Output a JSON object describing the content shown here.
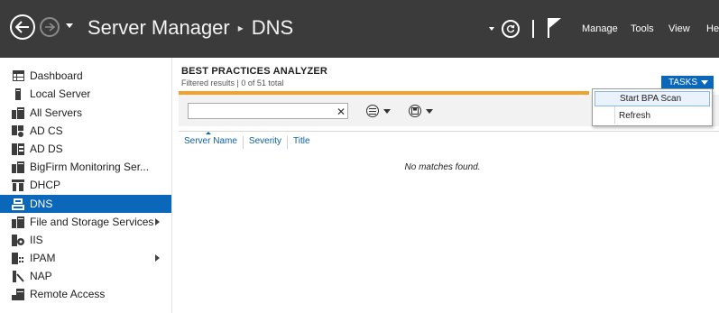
{
  "titlebar": {
    "crumbs": [
      "Server Manager",
      "DNS"
    ],
    "menus": [
      "Manage",
      "Tools",
      "View",
      "He"
    ]
  },
  "icons": {
    "back": "back-arrow-icon",
    "forward": "forward-arrow-icon",
    "refresh": "refresh-icon",
    "notifications": "flag-icon"
  },
  "sidebar": {
    "items": [
      {
        "label": "Dashboard",
        "icon": "dashboard-icon"
      },
      {
        "label": "Local Server",
        "icon": "local-server-icon"
      },
      {
        "label": "All Servers",
        "icon": "all-servers-icon"
      },
      {
        "label": "AD CS",
        "icon": "ad-cs-icon"
      },
      {
        "label": "AD DS",
        "icon": "ad-ds-icon"
      },
      {
        "label": "BigFirm Monitoring Ser...",
        "icon": "server-group-icon"
      },
      {
        "label": "DHCP",
        "icon": "dhcp-icon"
      },
      {
        "label": "DNS",
        "icon": "dns-icon",
        "selected": true
      },
      {
        "label": "File and Storage Services",
        "icon": "file-storage-icon",
        "expandable": true
      },
      {
        "label": "IIS",
        "icon": "iis-icon"
      },
      {
        "label": "IPAM",
        "icon": "ipam-icon",
        "expandable": true
      },
      {
        "label": "NAP",
        "icon": "nap-icon"
      },
      {
        "label": "Remote Access",
        "icon": "remote-access-icon"
      }
    ]
  },
  "main": {
    "title": "BEST PRACTICES ANALYZER",
    "subtitle": "Filtered results | 0 of 51 total",
    "tasks_label": "TASKS",
    "filter": {
      "value": "",
      "placeholder": ""
    },
    "columns": [
      "Server Name",
      "Severity",
      "Title"
    ],
    "empty_message": "No matches found."
  },
  "tasks_menu": {
    "items": [
      "Start BPA Scan",
      "Refresh"
    ]
  },
  "colors": {
    "titlebar": "#3b3b3b",
    "accent": "#0b67b9",
    "progress": "#f4a12c"
  }
}
